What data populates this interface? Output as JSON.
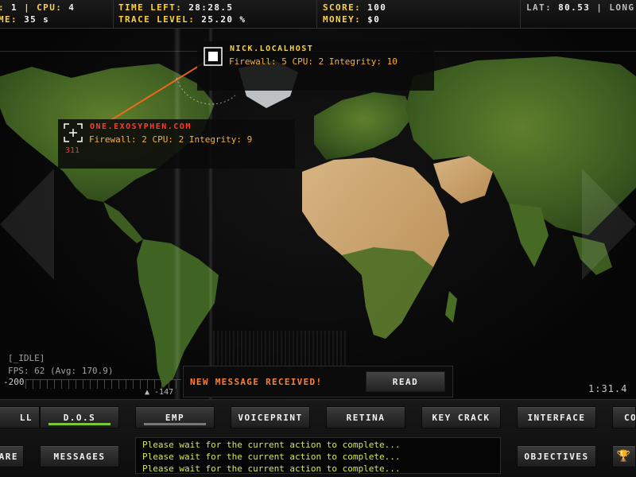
{
  "topbar": {
    "cells": [
      {
        "line1_label": ": ",
        "line1_value": "1",
        "line1_sep": " | ",
        "line1_label2": "CPU: ",
        "line1_value2": "4",
        "line2_label": "ME: ",
        "line2_value": "35 s"
      },
      {
        "line1_label": "TIME LEFT: ",
        "line1_value": "28:28.5",
        "line2_label": "TRACE LEVEL: ",
        "line2_value": "25.20 %"
      },
      {
        "line1_label": "SCORE: ",
        "line1_value": "100",
        "line2_label": "MONEY: ",
        "line2_value": "$0"
      },
      {
        "line1_label": "LAT: ",
        "line1_value": "80.53",
        "line1_sep": " | ",
        "line1_label2": "LONG",
        "line1_value2": ""
      }
    ]
  },
  "map": {
    "nodes": [
      {
        "name": "NICK.LOCALHOST",
        "name_color": "#ffd23a",
        "stats": "Firewall: 5 CPU: 2 Integrity: 10",
        "extra": ""
      },
      {
        "name": "ONE.EXOSYPHEN.COM",
        "name_color": "#ff3b2b",
        "stats": "Firewall: 2 CPU: 2 Integrity: 9",
        "extra": "311"
      }
    ],
    "status": "[_IDLE]",
    "fps": "FPS:  62 (Avg: 170.9)",
    "coord_left": "-200",
    "coord_marker": "▲ -147",
    "timer": "1:31.4"
  },
  "message": {
    "text": "NEW MESSAGE RECEIVED!",
    "read_label": "READ"
  },
  "buttons_row1": [
    {
      "label": "LL",
      "active": false
    },
    {
      "label": "D.O.S",
      "active": true,
      "bar_color": "#7dc63a",
      "progress": 1.0
    },
    {
      "label": "EMP",
      "active": false,
      "bar_color": "#777777",
      "progress": 1.0
    },
    {
      "label": "VOICEPRINT",
      "active": false
    },
    {
      "label": "RETINA",
      "active": false
    },
    {
      "label": "KEY CRACK",
      "active": false
    },
    {
      "label": "INTERFACE",
      "active": false
    },
    {
      "label": "CO",
      "active": false
    }
  ],
  "buttons_row2": [
    {
      "label": "ARE"
    },
    {
      "label": "MESSAGES"
    },
    {
      "label": "OBJECTIVES"
    },
    {
      "label": "🏆"
    }
  ],
  "console": {
    "lines": [
      "Please wait for the current action to complete...",
      "Please wait for the current action to complete...",
      "Please wait for the current action to complete..."
    ]
  },
  "colors": {
    "label_yellow": "#ffd23a",
    "message_orange": "#ff8030",
    "console_text": "#d7e84a",
    "stat_orange": "#ffb030",
    "alert_red": "#ff3030"
  }
}
